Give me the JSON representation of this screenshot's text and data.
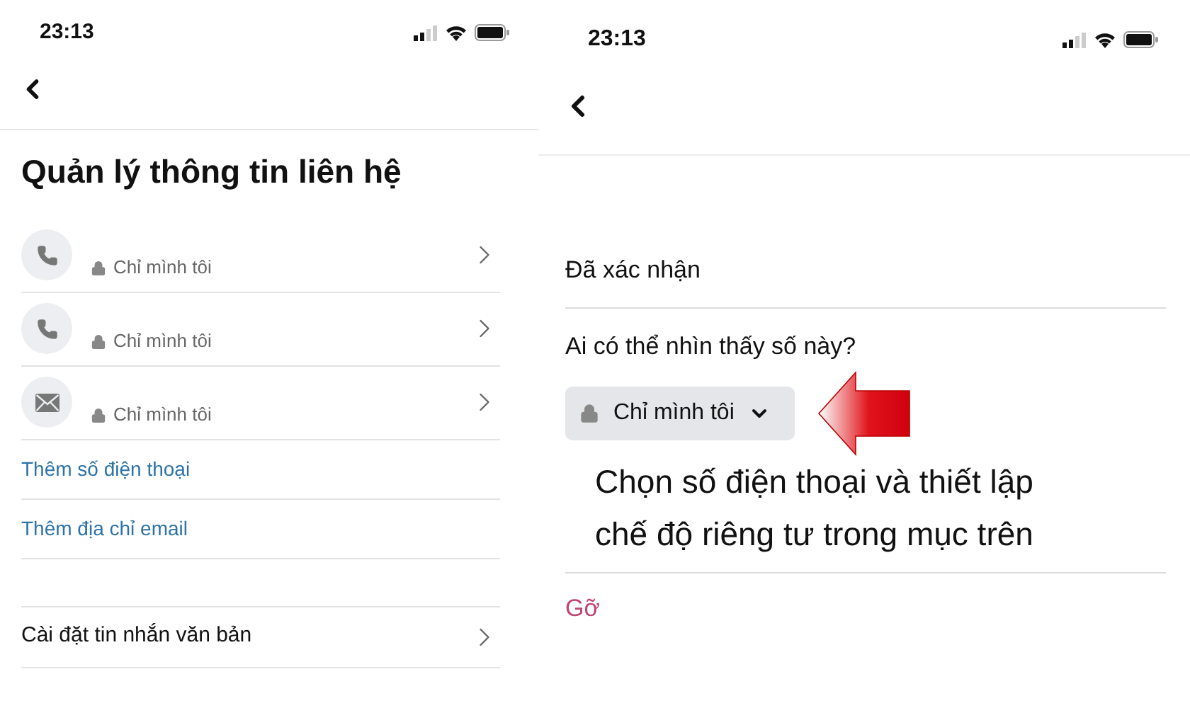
{
  "left_screen": {
    "status_bar": {
      "time": "23:13"
    },
    "title": "Quản lý thông tin liên hệ",
    "contacts": [
      {
        "kind": "phone",
        "privacy": "Chỉ mình tôi"
      },
      {
        "kind": "phone",
        "privacy": "Chỉ mình tôi"
      },
      {
        "kind": "email",
        "privacy": "Chỉ mình tôi"
      }
    ],
    "links": [
      "Thêm số điện thoại",
      "Thêm địa chỉ email"
    ],
    "settings_row": "Cài đặt tin nhắn văn bản"
  },
  "right_screen": {
    "status_bar": {
      "time": "23:13"
    },
    "status": "Đã xác nhận",
    "question": "Ai có thể nhìn thấy số này?",
    "audience_select": "Chỉ mình tôi",
    "annotation": "Chọn số điện thoại và thiết lập chế độ riêng tư trong mục trên",
    "remove_button": "Gỡ"
  }
}
